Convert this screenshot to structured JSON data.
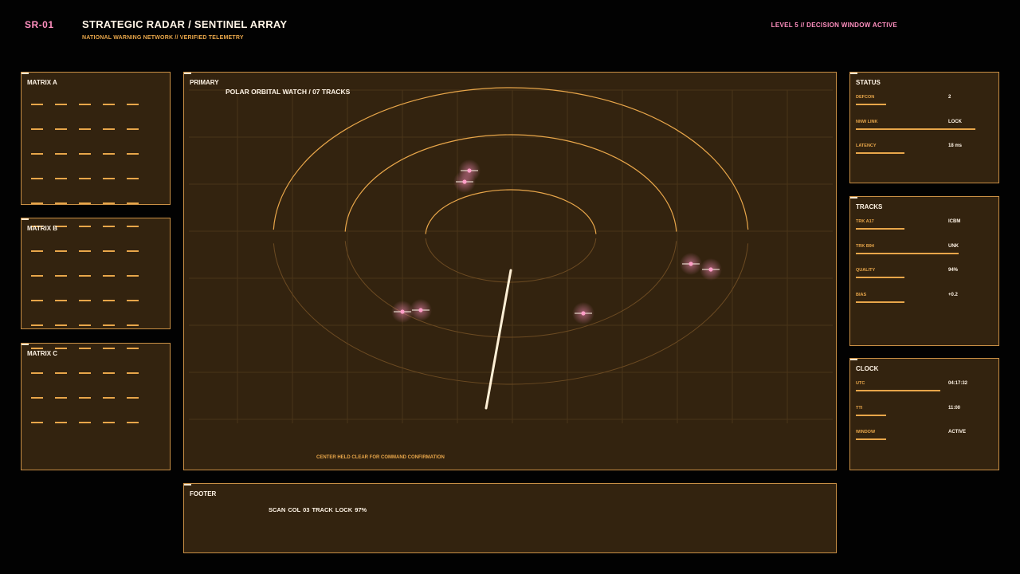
{
  "header": {
    "code": "SR-01",
    "title": "STRATEGIC RADAR / SENTINEL ARRAY",
    "subtitle": "NATIONAL WARNING NETWORK // VERIFIED TELEMETRY",
    "alert": "LEVEL 5 // DECISION WINDOW ACTIVE"
  },
  "matrices": [
    {
      "title": "MATRIX A"
    },
    {
      "title": "MATRIX B"
    },
    {
      "title": "MATRIX C"
    }
  ],
  "primary": {
    "title": "PRIMARY",
    "subtitle": "POLAR ORBITAL WATCH / 07 TRACKS",
    "note": "CENTER HELD CLEAR FOR COMMAND CONFIRMATION"
  },
  "status": {
    "title": "STATUS",
    "rows": [
      {
        "label": "DEFCON",
        "value": "2",
        "level": 0.22
      },
      {
        "label": "NNW LINK",
        "value": "LOCK",
        "level": 0.86
      },
      {
        "label": "LATENCY",
        "value": "18 ms",
        "level": 0.35
      }
    ]
  },
  "tracks": {
    "title": "TRACKS",
    "rows": [
      {
        "label": "TRK A17",
        "value": "ICBM",
        "level": 0.35
      },
      {
        "label": "TRK B94",
        "value": "UNK",
        "level": 0.74
      },
      {
        "label": "QUALITY",
        "value": "94%",
        "level": 0.35
      },
      {
        "label": "BIAS",
        "value": "+0.2",
        "level": 0.35
      }
    ]
  },
  "clock": {
    "title": "CLOCK",
    "rows": [
      {
        "label": "UTC",
        "value": "04:17:32",
        "level": 0.61
      },
      {
        "label": "TTI",
        "value": "11:00",
        "level": 0.22
      },
      {
        "label": "WINDOW",
        "value": "ACTIVE",
        "level": 0.22
      }
    ]
  },
  "footer": {
    "title": "FOOTER",
    "status": "SCAN COL 03  TRACK LOCK 97%"
  },
  "colors": {
    "accent": "#e8a64a",
    "alert": "#ff8fbf",
    "panel": "#33230f",
    "border": "#c98f45"
  }
}
